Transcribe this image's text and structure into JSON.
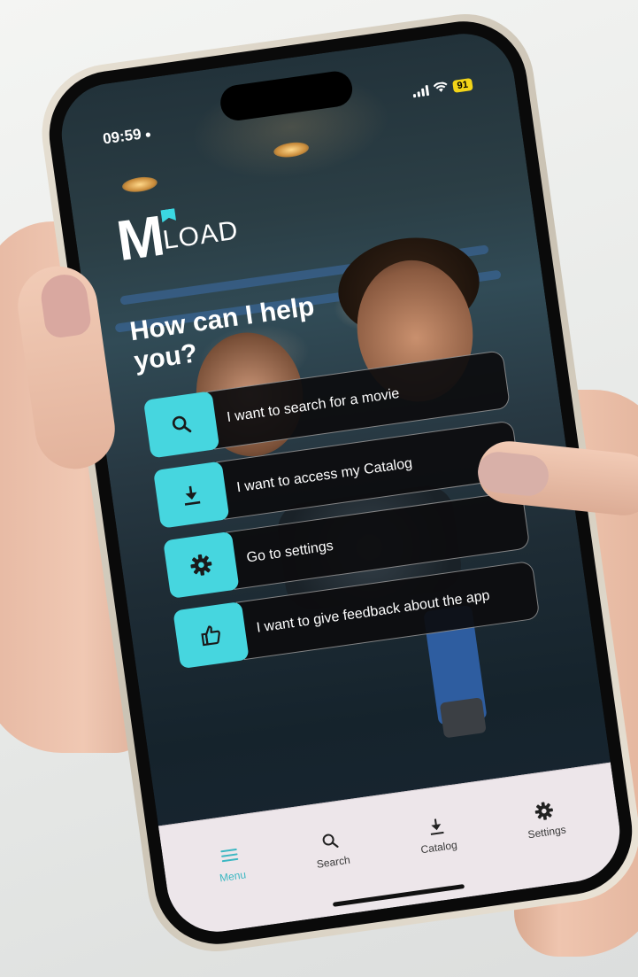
{
  "status_bar": {
    "time": "09:59",
    "battery": "91"
  },
  "app": {
    "logo_m": "M",
    "logo_load": "LOAD"
  },
  "main": {
    "heading": "How can I help you?",
    "options": [
      {
        "label": "I want to search for a movie",
        "icon": "search-icon"
      },
      {
        "label": "I want to access my Catalog",
        "icon": "download-icon"
      },
      {
        "label": "Go to settings",
        "icon": "gear-icon"
      },
      {
        "label": "I want to give feedback about the app",
        "icon": "thumbs-up-icon"
      }
    ]
  },
  "tab_bar": {
    "tabs": [
      {
        "label": "Menu",
        "icon": "menu-icon",
        "active": true
      },
      {
        "label": "Search",
        "icon": "search-icon",
        "active": false
      },
      {
        "label": "Catalog",
        "icon": "download-icon",
        "active": false
      },
      {
        "label": "Settings",
        "icon": "gear-icon",
        "active": false
      }
    ]
  },
  "colors": {
    "accent": "#46d6df",
    "tab_active": "#3bb7c2",
    "option_bg": "#0c0c0e",
    "tab_bar_bg": "#ede6ea",
    "battery": "#f2d418"
  }
}
